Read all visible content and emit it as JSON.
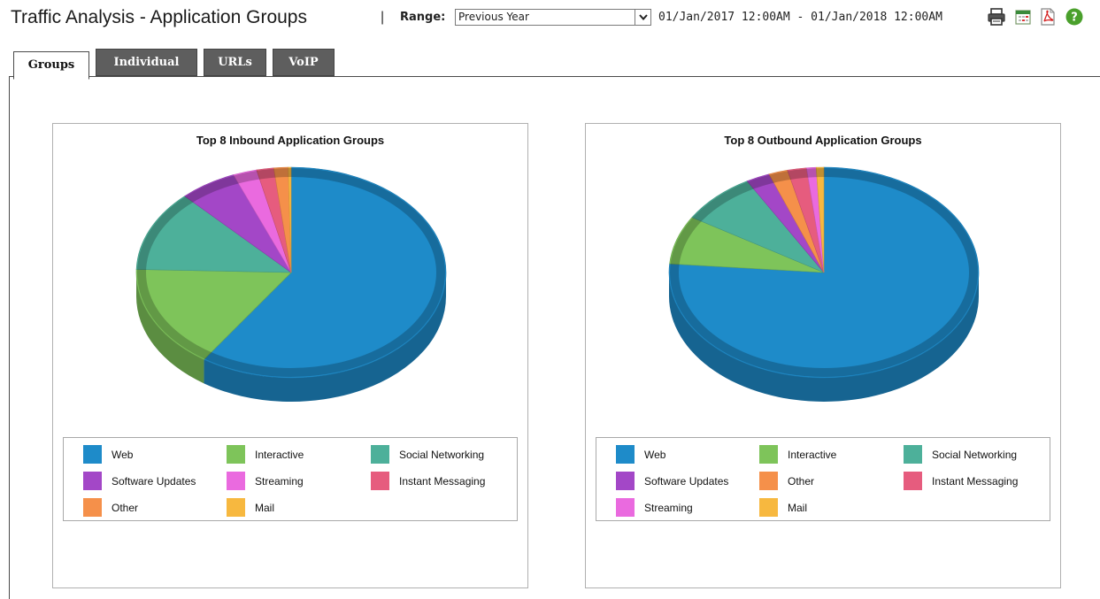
{
  "header": {
    "title": "Traffic Analysis - Application Groups",
    "separator": "|",
    "range_label": "Range:",
    "range_selected": "Previous Year",
    "date_range": "01/Jan/2017 12:00AM - 01/Jan/2018 12:00AM",
    "icons": [
      "printer-icon",
      "calendar-icon",
      "pdf-icon",
      "help-icon"
    ]
  },
  "tabs": [
    {
      "label": "Groups",
      "active": true
    },
    {
      "label": "Individual",
      "active": false
    },
    {
      "label": "URLs",
      "active": false
    },
    {
      "label": "VoIP",
      "active": false
    }
  ],
  "colors": {
    "Web": "#1e8bc9",
    "Interactive": "#7ec45a",
    "Social Networking": "#4db09a",
    "Software Updates": "#a347c7",
    "Streaming": "#ea6adf",
    "Instant Messaging": "#e65c7e",
    "Other": "#f5904a",
    "Mail": "#f7b83f"
  },
  "chart_data": [
    {
      "type": "pie",
      "title": "Top 8 Inbound Application Groups",
      "labels": [
        "Web",
        "Interactive",
        "Social Networking",
        "Software Updates",
        "Streaming",
        "Instant Messaging",
        "Other",
        "Mail"
      ],
      "values": [
        59.7,
        16.0,
        12.5,
        6.0,
        2.5,
        1.8,
        1.5,
        0.3
      ],
      "legend": [
        [
          "Web",
          "Interactive",
          "Social Networking"
        ],
        [
          "Software Updates",
          "Streaming",
          "Instant Messaging"
        ],
        [
          "Other",
          "Mail"
        ]
      ]
    },
    {
      "type": "pie",
      "title": "Top 8 Outbound Application Groups",
      "labels": [
        "Web",
        "Interactive",
        "Social Networking",
        "Software Updates",
        "Other",
        "Instant Messaging",
        "Streaming",
        "Mail"
      ],
      "values": [
        76.7,
        7.5,
        8.0,
        2.5,
        2.0,
        2.0,
        1.0,
        0.8
      ],
      "legend": [
        [
          "Web",
          "Interactive",
          "Social Networking"
        ],
        [
          "Software Updates",
          "Other",
          "Instant Messaging"
        ],
        [
          "Streaming",
          "Mail"
        ]
      ]
    }
  ]
}
